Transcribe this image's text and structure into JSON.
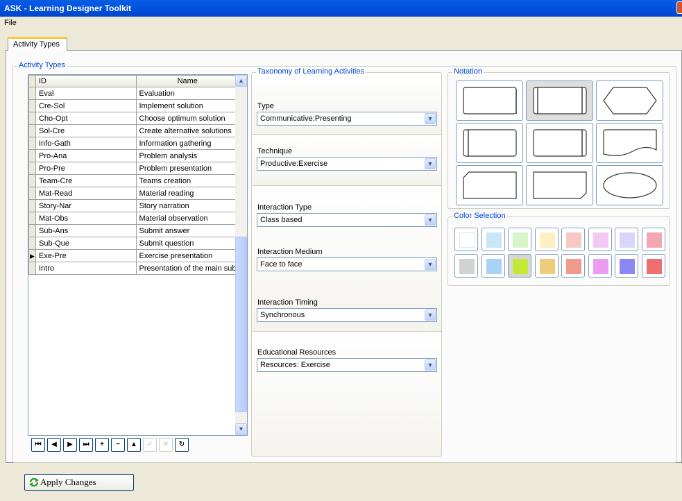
{
  "window": {
    "title": "ASK - Learning Designer Toolkit"
  },
  "menu": {
    "file": "File"
  },
  "tab": {
    "label": "Activity Types"
  },
  "activity_types": {
    "group_label": "Activity Types",
    "columns": {
      "id": "ID",
      "name": "Name"
    },
    "rows": [
      {
        "id": "Eval",
        "name": "Evaluation"
      },
      {
        "id": "Cre-Sol",
        "name": "Implement solution"
      },
      {
        "id": "Cho-Opt",
        "name": "Choose optimum solution"
      },
      {
        "id": "Sol-Cre",
        "name": "Create alternative solutions"
      },
      {
        "id": "Info-Gath",
        "name": "Information gathering"
      },
      {
        "id": "Pro-Ana",
        "name": "Problem analysis"
      },
      {
        "id": "Pro-Pre",
        "name": "Problem presentation"
      },
      {
        "id": "Team-Cre",
        "name": "Teams creation"
      },
      {
        "id": "Mat-Read",
        "name": "Material reading"
      },
      {
        "id": "Story-Nar",
        "name": "Story narration"
      },
      {
        "id": "Mat-Obs",
        "name": "Material observation"
      },
      {
        "id": "Sub-Ans",
        "name": "Submit answer"
      },
      {
        "id": "Sub-Que",
        "name": "Submit question"
      },
      {
        "id": "Exe-Pre",
        "name": "Exercise presentation"
      },
      {
        "id": "Intro",
        "name": "Presentation of the main subject"
      }
    ],
    "current_row_index": 13
  },
  "navigator": {
    "first": "⏮",
    "prev": "◀",
    "next": "▶",
    "last": "⏭",
    "insert": "+",
    "delete": "−",
    "edit": "▲",
    "post": "✓",
    "cancel": "✕",
    "refresh": "↻"
  },
  "taxonomy": {
    "group_label": "Taxonomy of Learning Activities",
    "type": {
      "label": "Type",
      "value": "Communicative:Presenting"
    },
    "technique": {
      "label": "Technique",
      "value": "Productive:Exercise"
    },
    "interaction_type": {
      "label": "Interaction Type",
      "value": "Class based"
    },
    "interaction_medium": {
      "label": "Interaction Medium",
      "value": "Face to face"
    },
    "interaction_timing": {
      "label": "Interaction Timing",
      "value": "Synchronous"
    },
    "educational_resources": {
      "label": "Educational Resources",
      "value": "Resources: Exercise"
    }
  },
  "notation": {
    "group_label": "Notation",
    "selected_index": 1,
    "shapes": [
      "rectangle",
      "double-bordered-rectangle",
      "hexagon",
      "left-bar-rectangle",
      "right-bar-rectangle",
      "document-wave",
      "cut-corner-rectangle",
      "cut-corner-rectangle-alt",
      "ellipse"
    ]
  },
  "color_selection": {
    "group_label": "Color Selection",
    "selected_index": 10,
    "colors": [
      "#ffffff",
      "#c7e6f8",
      "#d7f5c9",
      "#fbf1c4",
      "#f6c9c4",
      "#f2c9f4",
      "#d9d6fb",
      "#f3a7b3",
      "#d2d2d2",
      "#a9d2f8",
      "#c3e937",
      "#eecd7a",
      "#f09a8d",
      "#ec9df1",
      "#8b87f5",
      "#ed7071"
    ]
  },
  "apply_button": {
    "label": "Apply Changes"
  }
}
